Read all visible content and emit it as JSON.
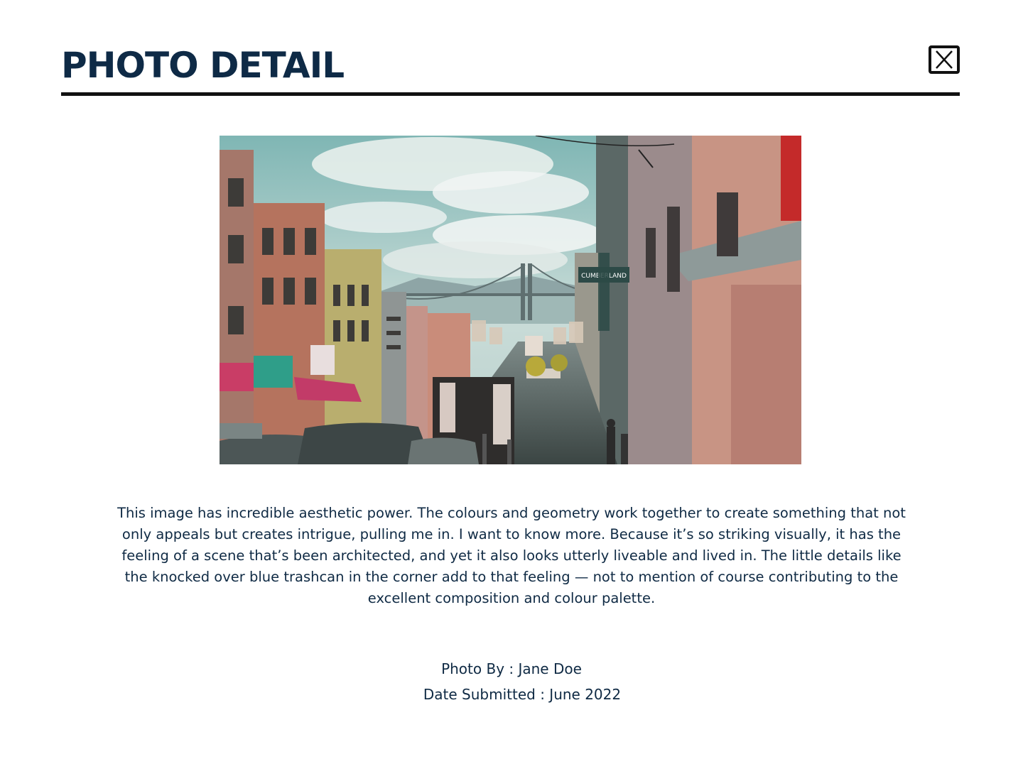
{
  "header": {
    "title": "PHOTO DETAIL",
    "close_icon": "close-x-icon"
  },
  "photo": {
    "alt": "Street view of San Francisco Chinatown looking down a hill toward the Bay Bridge"
  },
  "description": "This image has incredible aesthetic power. The colours and geometry work together to create something that not only appeals but creates intrigue, pulling me in. I want to know more. Because it’s so striking visually, it has the feeling of a scene that’s been architected, and yet it also looks utterly liveable and lived in. The little details like the knocked over blue trashcan in the corner add to that feeling — not to mention of course contributing to the excellent composition and colour palette.",
  "meta": {
    "author": "Photo By : Jane Doe",
    "date": "Date Submitted : June 2022"
  },
  "colors": {
    "title": "#0e2a46",
    "text": "#0f2a44",
    "divider": "#111111",
    "background": "#ffffff"
  }
}
